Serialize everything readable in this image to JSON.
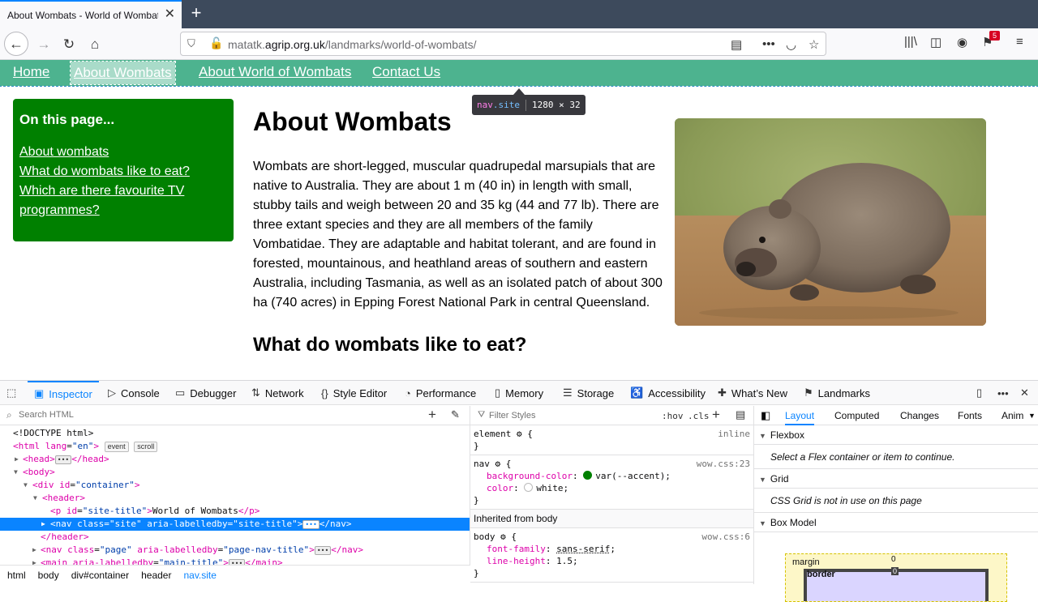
{
  "browser": {
    "tab_title": "About Wombats - World of Wombats",
    "url_host_prefix": "matatk.",
    "url_host": "agrip.org.uk",
    "url_path": "/landmarks/world-of-wombats/",
    "notification_count": "5"
  },
  "site_nav": {
    "items": [
      "Home",
      "About Wombats",
      "About World of Wombats",
      "Contact Us"
    ],
    "current_index": 1
  },
  "inspector_tooltip": {
    "tag": "nav",
    "class": ".site",
    "size": "1280 × 32"
  },
  "page_nav": {
    "title": "On this page...",
    "links": [
      "About wombats",
      "What do wombats like to eat?",
      "Which are there favourite TV",
      "programmes?"
    ]
  },
  "main": {
    "title": "About Wombats",
    "paragraph": "Wombats are short-legged, muscular quadrupedal marsupials that are native to Australia. They are about 1 m (40 in) in length with small, stubby tails and weigh between 20 and 35 kg (44 and 77 lb). There are three extant species and they are all members of the family Vombatidae. They are adaptable and habitat tolerant, and are found in forested, mountainous, and heathland areas of southern and eastern Australia, including Tasmania, as well as an isolated patch of about 300 ha (740 acres) in Epping Forest National Park in central Queensland.",
    "subheading": "What do wombats like to eat?"
  },
  "devtools": {
    "tabs": [
      "Inspector",
      "Console",
      "Debugger",
      "Network",
      "Style Editor",
      "Performance",
      "Memory",
      "Storage",
      "Accessibility",
      "What’s New",
      "Landmarks"
    ],
    "active_tab": "Inspector",
    "search_html_placeholder": "Search HTML",
    "filter_styles_placeholder": "Filter Styles",
    "hov_label": ":hov",
    "cls_label": ".cls",
    "tree": {
      "doctype": "<!DOCTYPE html>",
      "html_open": "<html",
      "html_attr": "lang",
      "html_val": "\"en\"",
      "badge_event": "event",
      "badge_scroll": "scroll",
      "head": "<head>",
      "head_close": "</head>",
      "body": "<body>",
      "div_open": "<div",
      "div_attr": "id",
      "div_val": "\"container\"",
      "header": "<header>",
      "p_open": "<p",
      "p_attr": "id",
      "p_val": "\"site-title\"",
      "p_text": "World of Wombats",
      "p_close": "</p>",
      "nav_open": "<nav",
      "nav_class_attr": "class",
      "nav_class_val": "\"site\"",
      "nav_aria_attr": "aria-labelledby",
      "nav_aria_val": "\"site-title\"",
      "nav_close": "</nav>",
      "header_close": "</header>",
      "nav2_class_val": "\"page\"",
      "nav2_aria_val": "\"page-nav-title\"",
      "main_open": "<main",
      "main_aria_val": "\"main-title\"",
      "main_close": "</main>"
    },
    "breadcrumbs": [
      "html",
      "body",
      "div#container",
      "header",
      "nav.site"
    ],
    "rules": {
      "element_selector": "element",
      "element_src": "inline",
      "nav_selector": "nav",
      "nav_src": "wow.css:23",
      "nav_bg_prop": "background-color",
      "nav_bg_val": "var(--accent);",
      "nav_bg_swatch": "#008000",
      "nav_color_prop": "color",
      "nav_color_val": "white;",
      "inherited_label": "Inherited from body",
      "body_selector": "body",
      "body_src": "wow.css:6",
      "body_ff_prop": "font-family",
      "body_ff_val": "sans-serif",
      "body_lh_prop": "line-height",
      "body_lh_val": "1.5;"
    },
    "layout_tabs": [
      "Layout",
      "Computed",
      "Changes",
      "Fonts",
      "Anim"
    ],
    "layout_active": "Layout",
    "flexbox_title": "Flexbox",
    "flexbox_msg": "Select a Flex container or item to continue.",
    "grid_title": "Grid",
    "grid_msg": "CSS Grid is not in use on this page",
    "boxmodel_title": "Box Model",
    "bm_margin_label": "margin",
    "bm_margin_value": "0",
    "bm_border_label": "border",
    "bm_border_value": "0"
  },
  "colors": {
    "site_nav_bg": "#4db38f",
    "page_nav_bg": "#008000",
    "accent_blue": "#0a84ff"
  }
}
